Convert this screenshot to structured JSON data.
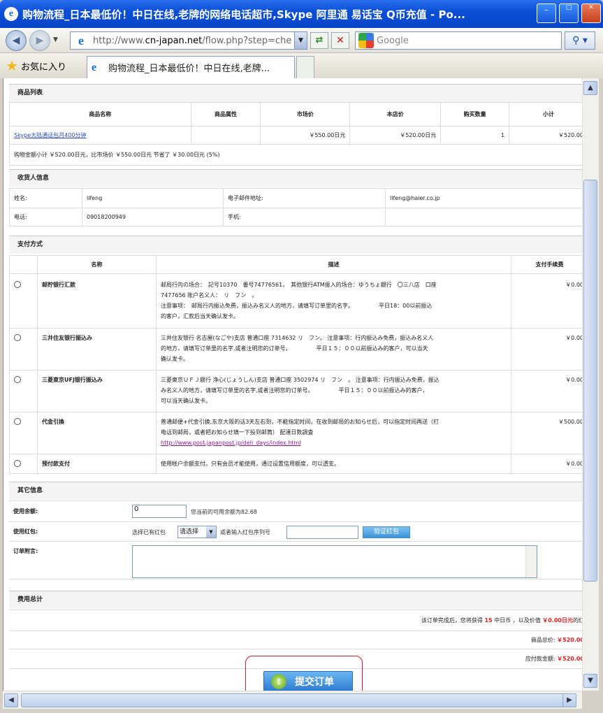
{
  "window": {
    "title": "购物流程_日本最低价！中日在线,老牌的网络电话超市,Skype 阿里通 易话宝 Q币充值 - Po...",
    "min_label": "_",
    "max_label": "□",
    "close_label": "✕"
  },
  "nav": {
    "back_label": "◀",
    "fwd_label": "▶",
    "dropdown_label": "▼",
    "ie_glyph": "e",
    "url_prefix": "http://www.",
    "url_domain": "cn-japan.net",
    "url_suffix": "/flow.php?step=che",
    "url_dropdown": "▼",
    "refresh_label": "⇄",
    "stop_label": "✕",
    "search_placeholder": "Google",
    "search_btn": "⚲ ▾"
  },
  "tabs": {
    "favorites": "お気に入り",
    "active_tab": "购物流程_日本最低价！中日在线,老牌..."
  },
  "goods": {
    "section_title": "商品列表",
    "headers": [
      "商品名称",
      "商品属性",
      "市场价",
      "本店价",
      "购买数量",
      "小计"
    ],
    "rows": [
      {
        "name": "Skype大陆通话包月400分钟",
        "attr": "",
        "market": "￥550.00日元",
        "price": "￥520.00日元",
        "qty": "1",
        "subtotal": "￥520.00"
      }
    ],
    "summary": "购物金额小计 ￥520.00日元，比市场价 ￥550.00日元 节省了 ￥30.00日元 (5%)"
  },
  "consignee": {
    "section_title": "收货人信息",
    "name_label": "姓名:",
    "name_value": "lifeng",
    "email_label": "电子邮件地址:",
    "email_value": "lifeng@haier.co.jp",
    "phone_label": "电话:",
    "phone_value": "09018200949",
    "mobile_label": "手机:",
    "mobile_value": ""
  },
  "payment": {
    "section_title": "支付方式",
    "headers": [
      "名称",
      "描述",
      "支付手续费"
    ],
    "rows": [
      {
        "name": "邮貯银行汇款",
        "desc1": "邮局行内の场合：　記号10370　番号74776561，　其他银行ATM振入的场合：ゆうちょ銀行　〇三八店　口座",
        "desc2": "7477656 账户名义人：　リ　フン　。",
        "desc3": "注意事项：　邮局行内振込免费，振込み名义人的地方，请填写订单里的名字。　　　　　平日18：00以前振込",
        "desc4": "的客户，汇款后当天确认发卡。",
        "fee": "￥0.00"
      },
      {
        "name": "三井住友银行振込み",
        "desc1": "三井住友银行 名古屋(なごや)支店 普通口座 7314632 リ　フン。 注意事项：行内振込み免费，振込み名义人",
        "desc2": "的地方，请填写订单里的名字,或者注明您的订单号。　　　　　平日１５：００以前振込み的客户，可以当天",
        "desc3": "确认发卡。",
        "desc4": "",
        "fee": "￥0.00"
      },
      {
        "name": "三菱東京UFJ银行振込み",
        "desc1": "三菱東京ＵＦＪ銀行 浄心(じょうしん)支店 普通口座 3502974 リ　フン　。 注意事项：行内振込み免费，振込",
        "desc2": "み名义人的地方，请填写订单里的名字,或者注明您的订单号。　　　　　平日１５：００以前振込み的客户，",
        "desc3": "可以当天确认发卡。",
        "desc4": "",
        "fee": "￥0.00"
      },
      {
        "name": "代金引換",
        "desc1": "普通邮便+代金引换,东京大阪的话3天左右到，不能指定时间，在收到邮局的お知らせ后，可以指定时间再送（打",
        "desc2": "电话到邮局，或者把お知らせ填一下投到邮筒） 配達日数調査",
        "desc3": "http://www.post.japanpost.jp/deli_days/index.html",
        "desc4": "",
        "fee": "￥500.00"
      },
      {
        "name": "预付款支付",
        "desc1": "使用帐户余额支付。只有会员才能使用，通过设置信用额度，可以透支。",
        "desc2": "",
        "desc3": "",
        "desc4": "",
        "fee": "￥0.00"
      }
    ]
  },
  "other": {
    "section_title": "其它信息",
    "balance_label": "使用余额:",
    "balance_value": "0",
    "balance_note": "您当前的可用余额为82.68",
    "bonus_label": "使用红包:",
    "bonus_prefix": "选择已有红包",
    "bonus_select": "请选择",
    "bonus_or": "或者输入红包序列号",
    "bonus_btn": "验证红包",
    "remark_label": "订单附言:"
  },
  "total": {
    "section_title": "费用总计",
    "points_prefix": "该订单完成后，您将获得",
    "points_num": "15",
    "points_mid": "中日币 ，以及价值",
    "points_value": "￥0.00日元",
    "points_suffix": "的红",
    "goods_total_label": "商品总价:",
    "goods_total_value": "￥520.00",
    "amount_label": "应付款金额:",
    "amount_value": "￥520.00"
  },
  "submit": {
    "label": "提交订单",
    "icon": "⇧"
  },
  "scroll": {
    "up": "▲",
    "down": "▼",
    "left": "◀",
    "right": "▶"
  }
}
